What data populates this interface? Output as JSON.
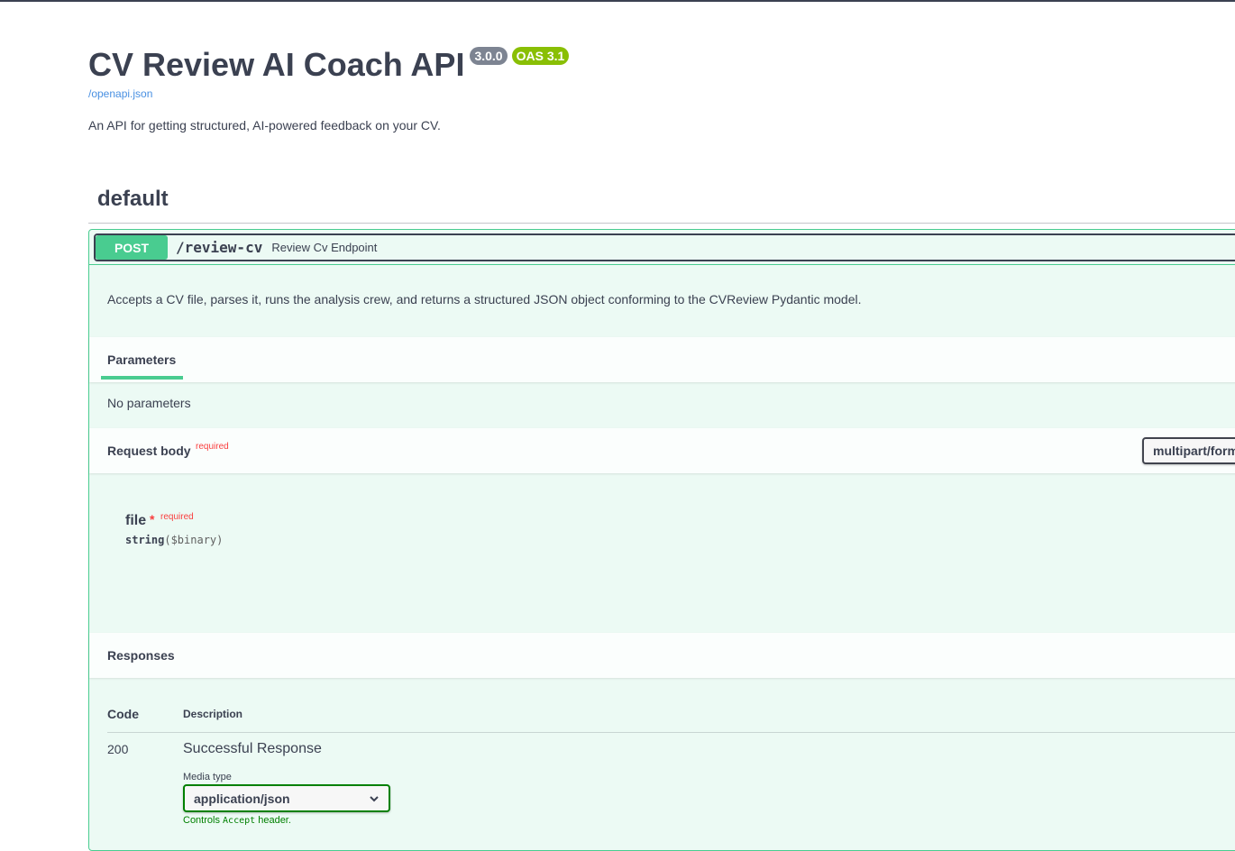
{
  "info": {
    "title": "CV Review AI Coach API",
    "version_badge": "3.0.0",
    "oas_badge": "OAS 3.1",
    "spec_link": "/openapi.json",
    "description": "An API for getting structured, AI-powered feedback on your CV."
  },
  "tag": {
    "name": "default"
  },
  "operation": {
    "method": "POST",
    "path": "/review-cv",
    "summary": "Review Cv Endpoint",
    "description": "Accepts a CV file, parses it, runs the analysis crew, and returns a structured JSON object conforming to the CVReview Pydantic model.",
    "parameters_tab": "Parameters",
    "no_parameters": "No parameters",
    "request_body": {
      "title": "Request body",
      "required_label": "required",
      "content_type": "multipart/form-data",
      "field_name": "file",
      "field_star": "*",
      "field_required": "required",
      "field_type": "string",
      "field_format": "($binary)"
    },
    "responses": {
      "title": "Responses",
      "col_code": "Code",
      "col_description": "Description",
      "rows": [
        {
          "code": "200",
          "description": "Successful Response",
          "media_type_label": "Media type",
          "media_type": "application/json",
          "help_prefix": "Controls",
          "help_code": "Accept",
          "help_suffix": "header."
        }
      ]
    }
  },
  "colors": {
    "post": "#49cc90",
    "required": "#f93e3e",
    "link": "#4990e2",
    "version_badge": "#7d8492",
    "oas_badge": "#89bf04"
  }
}
